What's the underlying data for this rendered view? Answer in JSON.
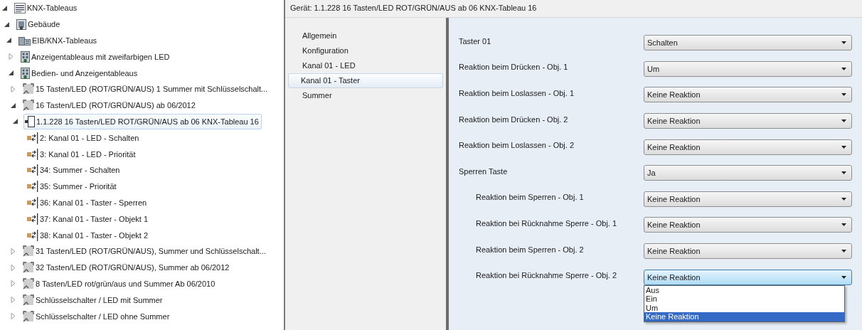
{
  "tree": [
    {
      "label": "KNX-Tableaus",
      "kind": "root",
      "expanded": true,
      "selected": false,
      "children": [
        {
          "label": "Gebäude",
          "kind": "building",
          "expanded": true,
          "selected": false,
          "children": [
            {
              "label": "EIB/KNX-Tableaus",
              "kind": "buildings",
              "expanded": true,
              "selected": false,
              "children": [
                {
                  "label": "Anzeigentableaus mit zweifarbigen LED",
                  "kind": "tower",
                  "expanded": false,
                  "selected": false
                },
                {
                  "label": "Bedien- und Anzeigentableaus",
                  "kind": "tower",
                  "expanded": true,
                  "selected": false,
                  "children": [
                    {
                      "label": "15 Tasten/LED (ROT/GRÜN/AUS) 1 Summer mit Schlüsselschalt...",
                      "kind": "product",
                      "expanded": false,
                      "selected": false
                    },
                    {
                      "label": "16 Tasten/LED (ROT/GRÜN/AUS) ab 06/2012",
                      "kind": "product",
                      "expanded": true,
                      "selected": false,
                      "children": [
                        {
                          "label": "1.1.228 16 Tasten/LED ROT/GRÜN/AUS ab 06 KNX-Tableau 16",
                          "kind": "device",
                          "expanded": true,
                          "selected": true,
                          "children": [
                            {
                              "label": "2: Kanal 01 - LED - Schalten",
                              "kind": "object",
                              "selected": false
                            },
                            {
                              "label": "3: Kanal 01 - LED - Priorität",
                              "kind": "object",
                              "selected": false
                            },
                            {
                              "label": "34: Summer - Schalten",
                              "kind": "object",
                              "selected": false
                            },
                            {
                              "label": "35: Summer - Priorität",
                              "kind": "object",
                              "selected": false
                            },
                            {
                              "label": "36: Kanal 01 - Taster - Sperren",
                              "kind": "object",
                              "selected": false
                            },
                            {
                              "label": "37: Kanal 01 - Taster - Objekt 1",
                              "kind": "object",
                              "selected": false
                            },
                            {
                              "label": "38: Kanal 01 - Taster - Objekt 2",
                              "kind": "object",
                              "selected": false
                            }
                          ]
                        }
                      ]
                    },
                    {
                      "label": "31 Tasten/LED (ROT/GRÜN/AUS), Summer und Schlüsselschalt...",
                      "kind": "product",
                      "expanded": false,
                      "selected": false
                    },
                    {
                      "label": "32 Tasten/LED (ROT/GRÜN/AUS), Summer ab 06/2012",
                      "kind": "product",
                      "expanded": false,
                      "selected": false
                    },
                    {
                      "label": "8 Tasten/LED rot/grün/aus und Summer Ab 06/2010",
                      "kind": "product",
                      "expanded": false,
                      "selected": false
                    },
                    {
                      "label": "Schlüsselschalter / LED mit Summer",
                      "kind": "product",
                      "expanded": false,
                      "selected": false
                    },
                    {
                      "label": "Schlüsselschalter / LED ohne Summer",
                      "kind": "product",
                      "expanded": false,
                      "selected": false
                    }
                  ]
                }
              ]
            }
          ]
        }
      ]
    }
  ],
  "device_header": "Gerät: 1.1.228 16 Tasten/LED ROT/GRÜN/AUS ab 06 KNX-Tableau 16",
  "nav": [
    {
      "label": "Allgemein",
      "selected": false
    },
    {
      "label": "Konfiguration",
      "selected": false
    },
    {
      "label": "Kanal 01 - LED",
      "selected": false
    },
    {
      "label": "Kanal 01 - Taster",
      "selected": true
    },
    {
      "label": "Summer",
      "selected": false
    }
  ],
  "parameters": [
    {
      "label": "Taster 01",
      "value": "Schalten",
      "open": false
    },
    {
      "label": "Reaktion beim Drücken - Obj. 1",
      "value": "Um",
      "open": false
    },
    {
      "label": "Reaktion beim Loslassen - Obj. 1",
      "value": "Keine Reaktion",
      "open": false
    },
    {
      "label": "Reaktion beim Drücken - Obj. 2",
      "value": "Keine Reaktion",
      "open": false
    },
    {
      "label": "Reaktion beim Loslassen - Obj. 2",
      "value": "Keine Reaktion",
      "open": false
    },
    {
      "label": "Sperren Taste",
      "value": "Ja",
      "open": false,
      "children": [
        {
          "label": "Reaktion beim Sperren - Obj. 1",
          "value": "Keine Reaktion",
          "open": false
        },
        {
          "label": "Reaktion bei Rücknahme Sperre - Obj. 1",
          "value": "Keine Reaktion",
          "open": false
        },
        {
          "label": "Reaktion beim Sperren - Obj. 2",
          "value": "Keine Reaktion",
          "open": false
        },
        {
          "label": "Reaktion bei Rücknahme Sperre - Obj. 2",
          "value": "Keine Reaktion",
          "open": true,
          "options": [
            {
              "label": "Aus",
              "selected": false
            },
            {
              "label": "Ein",
              "selected": false
            },
            {
              "label": "Um",
              "selected": false
            },
            {
              "label": "Keine Reaktion",
              "selected": true
            }
          ]
        }
      ]
    }
  ]
}
